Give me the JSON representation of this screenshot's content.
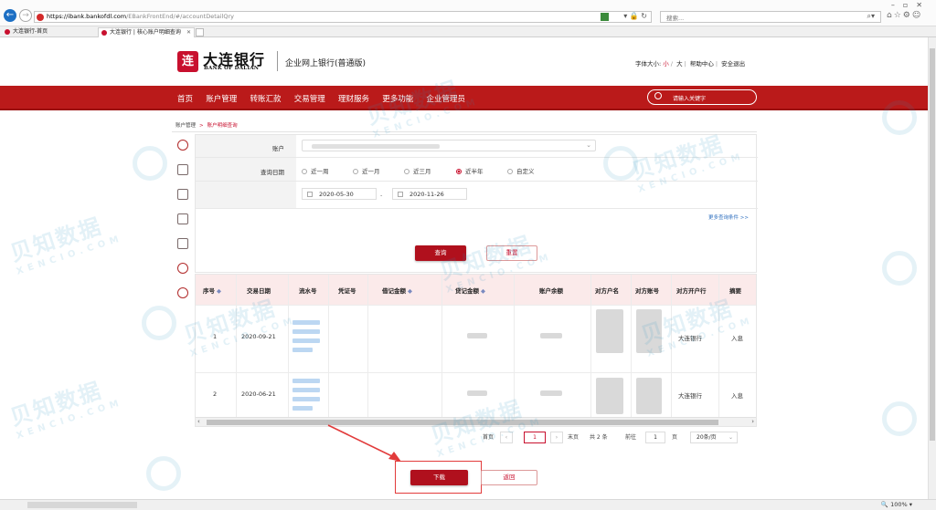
{
  "browser": {
    "url_host": "https://ibank.bankofdl.com",
    "url_path": "/EBankFrontEnd/#/accountDetailQry",
    "search_placeholder": "搜索...",
    "zoom": "100%",
    "tabs": [
      {
        "label": "大连银行-首页"
      },
      {
        "label": "大连银行 | 核心账户明细查询"
      }
    ]
  },
  "header": {
    "logo_char": "连",
    "bank_name_cn": "大连银行",
    "bank_name_en": "BANK OF DALIAN",
    "subtitle": "企业网上银行(普通版)",
    "font_size_label": "字体大小:",
    "font_small": "小",
    "font_large": "大",
    "help": "帮助中心",
    "logout": "安全退出"
  },
  "menu": {
    "items": [
      "首页",
      "账户管理",
      "转账汇款",
      "交易管理",
      "理财服务",
      "更多功能",
      "企业管理员"
    ],
    "search_placeholder": "请输入关键字"
  },
  "breadcrumb": {
    "parent": "账户管理",
    "separator": ">",
    "current": "账户明细查询"
  },
  "form": {
    "account_label": "账户",
    "period_label": "查询日期",
    "periods": [
      {
        "label": "近一周",
        "selected": false
      },
      {
        "label": "近一月",
        "selected": false
      },
      {
        "label": "近三月",
        "selected": false
      },
      {
        "label": "近半年",
        "selected": true
      },
      {
        "label": "自定义",
        "selected": false
      }
    ],
    "start_date": "2020-05-30",
    "date_separator": "-",
    "end_date": "2020-11-26",
    "more_conditions": "更多查询条件 >>",
    "query_button": "查询",
    "reset_button": "重置"
  },
  "table": {
    "columns": [
      "序号",
      "交易日期",
      "流水号",
      "凭证号",
      "借记金额",
      "贷记金额",
      "账户余额",
      "对方户名",
      "对方账号",
      "对方开户行",
      "摘要"
    ],
    "sortable": [
      "序号",
      "借记金额",
      "贷记金额"
    ],
    "sort_icon": "◆",
    "rows": [
      {
        "index": "1",
        "date": "2020-09-21",
        "bank": "大连银行",
        "summary": "入息"
      },
      {
        "index": "2",
        "date": "2020-06-21",
        "bank": "大连银行",
        "summary": "入息"
      }
    ]
  },
  "pagination": {
    "first": "首页",
    "page": "1",
    "last": "末页",
    "total": "共 2 条",
    "goto": "前往",
    "goto_value": "1",
    "page_unit": "页",
    "page_size": "20条/页"
  },
  "actions": {
    "download": "下载",
    "back": "返回"
  },
  "watermark": {
    "text": "贝知数据",
    "sub": "XENCIO.COM"
  },
  "colors": {
    "brand_red": "#ba1a1a",
    "button_red": "#b0101d",
    "highlight": "#e23b3b"
  }
}
